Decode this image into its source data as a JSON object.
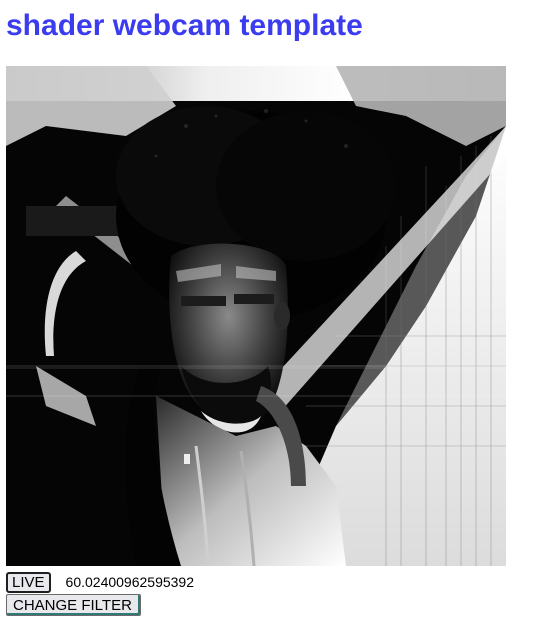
{
  "page": {
    "title": "shader webcam template"
  },
  "video": {
    "description_icon": "webcam-video-frame"
  },
  "controls": {
    "live_label": "LIVE",
    "fps_value": "60.02400962595392",
    "change_filter_label": "CHANGE FILTER"
  },
  "colors": {
    "title": "#3b3bf0",
    "button_bg": "#e9e9ed",
    "filter_button_accent": "#2f7a75"
  }
}
